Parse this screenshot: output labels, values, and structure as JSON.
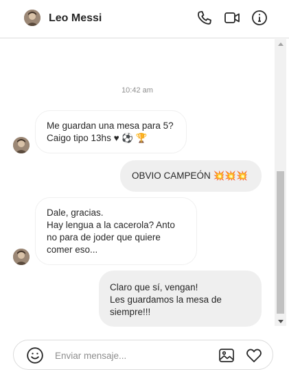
{
  "header": {
    "contact_name": "Leo Messi",
    "icons": [
      "phone-icon",
      "video-camera-icon",
      "info-icon"
    ]
  },
  "conversation": {
    "timestamp": "10:42 am",
    "messages": [
      {
        "direction": "incoming",
        "lines": [
          "Me guardan una mesa para 5?",
          "Caigo tipo 13hs ♥ ⚽ 🏆"
        ]
      },
      {
        "direction": "outgoing",
        "lines": [
          "OBVIO CAMPEÓN 💥💥💥"
        ]
      },
      {
        "direction": "incoming",
        "lines": [
          "Dale, gracias.",
          "Hay lengua a la cacerola? Anto",
          "no para de joder que quiere",
          "comer eso..."
        ]
      },
      {
        "direction": "outgoing",
        "lines": [
          "Claro que sí, vengan!",
          "Les guardamos la mesa de",
          "siempre!!!"
        ]
      }
    ]
  },
  "composer": {
    "placeholder": "Enviar mensaje...",
    "value": "",
    "icons": [
      "emoji-icon",
      "image-icon",
      "heart-icon"
    ]
  },
  "colors": {
    "incoming_bubble_border": "#efefef",
    "outgoing_bubble": "#efefef",
    "text": "#262626",
    "muted": "#8e8e8e"
  }
}
